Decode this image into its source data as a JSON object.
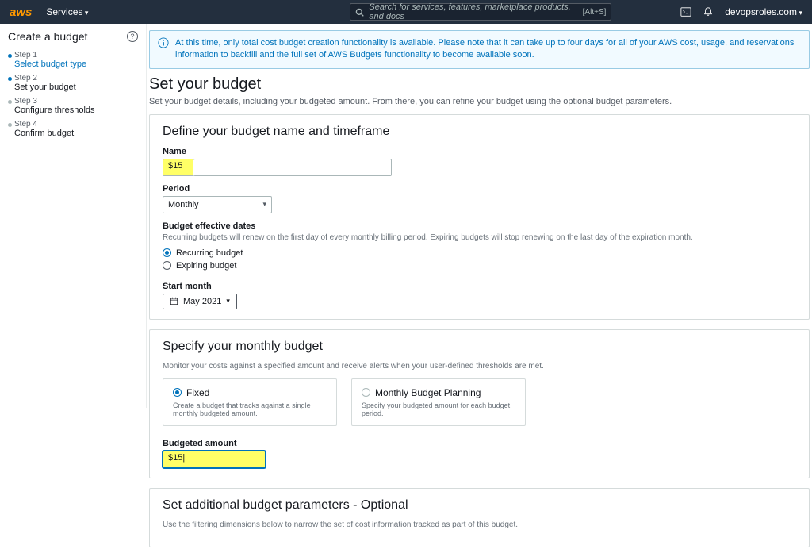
{
  "topnav": {
    "logo": "aws",
    "services": "Services",
    "searchPlaceholder": "Search for services, features, marketplace products, and docs",
    "searchShortcut": "[Alt+S]",
    "username": "devopsroles.com"
  },
  "sidebar": {
    "title": "Create a budget",
    "steps": [
      {
        "lbl": "Step 1",
        "name": "Select budget type"
      },
      {
        "lbl": "Step 2",
        "name": "Set your budget"
      },
      {
        "lbl": "Step 3",
        "name": "Configure thresholds"
      },
      {
        "lbl": "Step 4",
        "name": "Confirm budget"
      }
    ]
  },
  "info": "At this time, only total cost budget creation functionality is available. Please note that it can take up to four days for all of your AWS cost, usage, and reservations information to backfill and the full set of AWS Budgets functionality to become available soon.",
  "page": {
    "h1": "Set your budget",
    "sub": "Set your budget details, including your budgeted amount. From there, you can refine your budget using the optional budget parameters."
  },
  "define": {
    "h2": "Define your budget name and timeframe",
    "nameLbl": "Name",
    "nameVal": "$15",
    "periodLbl": "Period",
    "periodVal": "Monthly",
    "effLbl": "Budget effective dates",
    "effHint": "Recurring budgets will renew on the first day of every monthly billing period. Expiring budgets will stop renewing on the last day of the expiration month.",
    "r1": "Recurring budget",
    "r2": "Expiring budget",
    "startLbl": "Start month",
    "startVal": "May 2021"
  },
  "specify": {
    "h2": "Specify your monthly budget",
    "desc": "Monitor your costs against a specified amount and receive alerts when your user-defined thresholds are met.",
    "card1t": "Fixed",
    "card1d": "Create a budget that tracks against a single monthly budgeted amount.",
    "card2t": "Monthly Budget Planning",
    "card2d": "Specify your budgeted amount for each budget period.",
    "amtLbl": "Budgeted amount",
    "amtVal": "$15|"
  },
  "extra": {
    "h2": "Set additional budget parameters - Optional",
    "desc": "Use the filtering dimensions below to narrow the set of cost information tracked as part of this budget."
  }
}
